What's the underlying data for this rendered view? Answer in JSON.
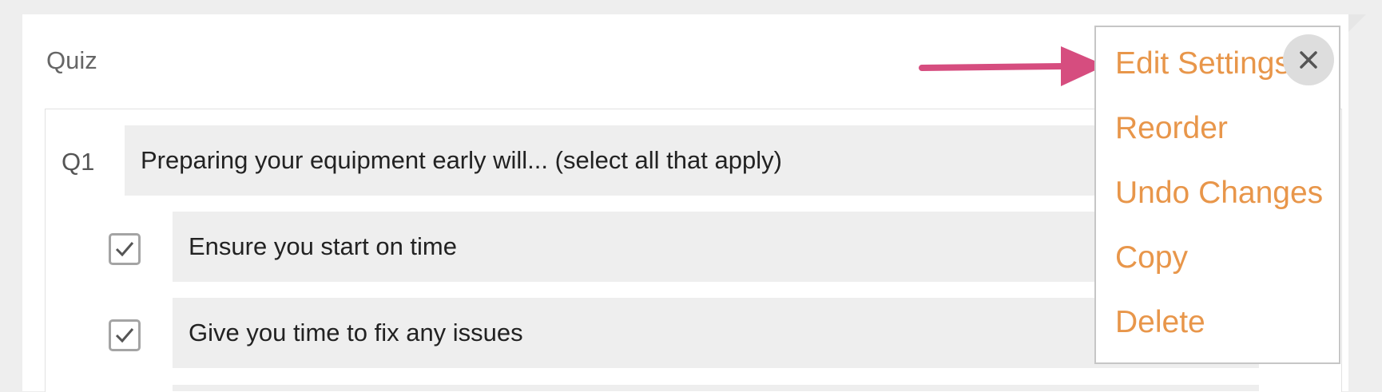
{
  "quiz": {
    "title": "Quiz"
  },
  "question": {
    "number": "Q1",
    "text": "Preparing your equipment early will... (select all that apply)",
    "answers": [
      {
        "label": "Ensure you start on time",
        "checked": true
      },
      {
        "label": "Give you time to fix any issues",
        "checked": true
      }
    ]
  },
  "menu": {
    "items": [
      {
        "label": "Edit Settings"
      },
      {
        "label": "Reorder"
      },
      {
        "label": "Undo Changes"
      },
      {
        "label": "Copy"
      },
      {
        "label": "Delete"
      }
    ],
    "close_icon": "close-icon"
  },
  "colors": {
    "menu_text": "#e8964a",
    "arrow": "#d64d7f",
    "field_bg": "#eeeeee"
  }
}
